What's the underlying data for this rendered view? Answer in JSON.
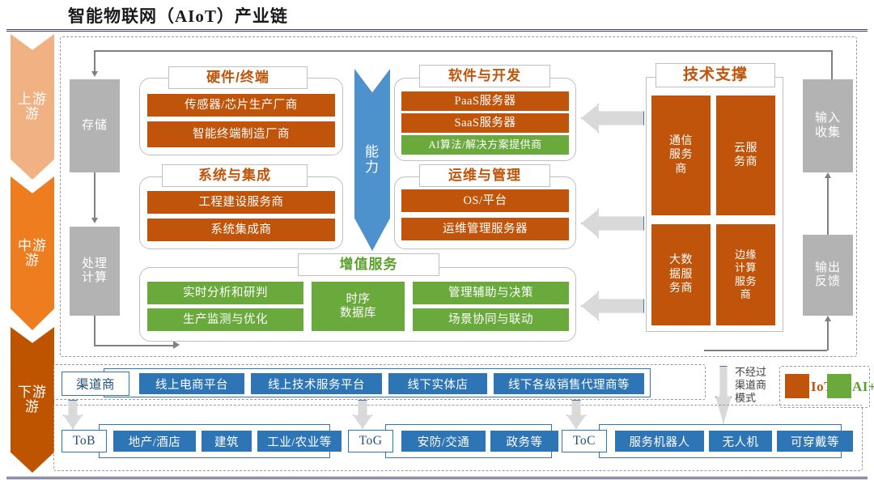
{
  "title": "智能物联网（AIoT）产业链",
  "stages": [
    {
      "name": "upstream",
      "label": "上游",
      "color": "#f2b183"
    },
    {
      "name": "midstream",
      "label": "中游",
      "color": "#ed7d1f"
    },
    {
      "name": "downstream",
      "label": "下游",
      "color": "#bf5400"
    }
  ],
  "pipeline": {
    "storage": "存储",
    "compute": "处理\n计算",
    "compute_line1": "处理",
    "compute_line2": "计算",
    "input_line1": "输入",
    "input_line2": "收集",
    "output_line1": "输出",
    "output_line2": "反馈"
  },
  "capability_arrow": {
    "line1": "能",
    "line2": "力",
    "color": "#4e92cd"
  },
  "groups": [
    {
      "name": "hardware-terminal",
      "title": "硬件/终端",
      "title_color": "#c0540a",
      "items": [
        {
          "label": "传感器/芯片生产厂商",
          "type": "iot"
        },
        {
          "label": "智能终端制造厂商",
          "type": "iot"
        }
      ]
    },
    {
      "name": "software-development",
      "title": "软件与开发",
      "title_color": "#c0540a",
      "items": [
        {
          "label": "PaaS服务器",
          "type": "iot"
        },
        {
          "label": "SaaS服务器",
          "type": "iot"
        },
        {
          "label": "AI算法/解决方案提供商",
          "type": "ai"
        }
      ]
    },
    {
      "name": "system-integration",
      "title": "系统与集成",
      "title_color": "#c0540a",
      "items": [
        {
          "label": "工程建设服务商",
          "type": "iot"
        },
        {
          "label": "系统集成商",
          "type": "iot"
        }
      ]
    },
    {
      "name": "ops-management",
      "title": "运维与管理",
      "title_color": "#c0540a",
      "items": [
        {
          "label": "OS/平台",
          "type": "iot"
        },
        {
          "label": "运维管理服务器",
          "type": "iot"
        }
      ]
    },
    {
      "name": "value-added-services",
      "title": "增值服务",
      "title_color": "#5aa02c",
      "items": [
        {
          "label": "实时分析和研判",
          "type": "ai"
        },
        {
          "label": "生产监测与优化",
          "type": "ai"
        },
        {
          "label": "时序数据库",
          "type": "ai"
        },
        {
          "label": "管理辅助与决策",
          "type": "ai"
        },
        {
          "label": "场景协同与联动",
          "type": "ai"
        }
      ],
      "timeseries_line1": "时序",
      "timeseries_line2": "数据库"
    }
  ],
  "tech_support": {
    "title": "技术支撑",
    "title_color": "#c0540a",
    "boxes": [
      {
        "label": "通信服务商",
        "l1": "通信",
        "l2": "服务",
        "l3": "商"
      },
      {
        "label": "云服务商",
        "l1": "云服",
        "l2": "务商",
        "l3": ""
      },
      {
        "label": "大数据服务商",
        "l1": "大数",
        "l2": "据服",
        "l3": "务商"
      },
      {
        "label": "边缘计算服务商",
        "l1": "边缘",
        "l2": "计算",
        "l3": "服务",
        "l4": "商"
      }
    ]
  },
  "channel": {
    "header": "渠道商",
    "items": [
      "线上电商平台",
      "线上技术服务平台",
      "线下实体店",
      "线下各级销售代理商等"
    ]
  },
  "no_channel_note": {
    "line1": "不经过",
    "line2": "渠道商",
    "line3": "模式"
  },
  "legend": {
    "items": [
      {
        "label": "IoT",
        "color": "#bf540a"
      },
      {
        "label": "AI+",
        "color": "#6aaa3c"
      }
    ]
  },
  "downstream": [
    {
      "name": "tob",
      "header": "ToB",
      "items": [
        "地产/酒店",
        "建筑",
        "工业/农业等"
      ]
    },
    {
      "name": "tog",
      "header": "ToG",
      "items": [
        "安防/交通",
        "政务等"
      ]
    },
    {
      "name": "toc",
      "header": "ToC",
      "items": [
        "服务机器人",
        "无人机",
        "可穿戴等"
      ]
    }
  ]
}
